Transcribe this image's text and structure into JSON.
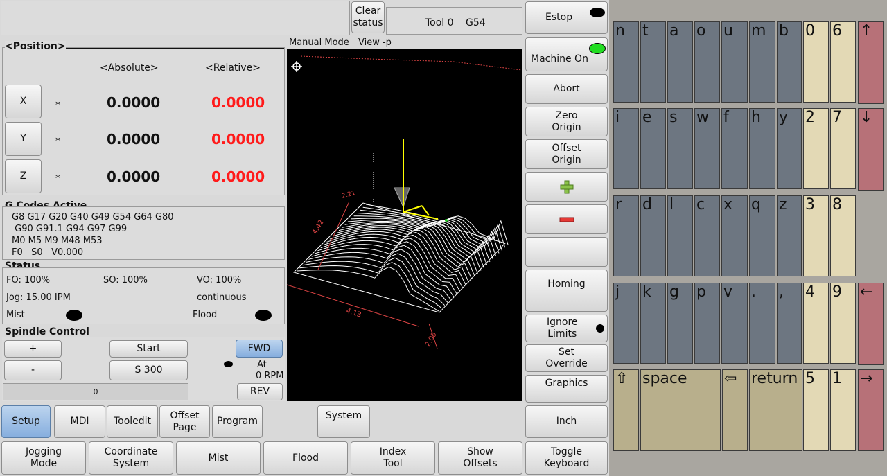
{
  "top": {
    "clear_status": "Clear\nstatus",
    "tool": "Tool 0",
    "coord": "G54"
  },
  "position": {
    "title": "<Position>",
    "abs_header": "<Absolute>",
    "rel_header": "<Relative>",
    "axes": [
      {
        "label": "X",
        "marker": "*",
        "abs": "0.0000",
        "rel": "0.0000"
      },
      {
        "label": "Y",
        "marker": "*",
        "abs": "0.0000",
        "rel": "0.0000"
      },
      {
        "label": "Z",
        "marker": "*",
        "abs": "0.0000",
        "rel": "0.0000"
      }
    ]
  },
  "gcodes": {
    "title": "G Codes Active",
    "lines": [
      "G8 G17 G20 G40 G49 G54 G64 G80",
      " G90 G91.1 G94 G97 G99",
      "M0 M5 M9 M48 M53",
      "F0   S0   V0.000"
    ]
  },
  "status": {
    "title": "Status",
    "fo": "FO: 100%",
    "so": "SO: 100%",
    "vo": "VO: 100%",
    "jog": "Jog: 15.00 IPM",
    "mode": "continuous",
    "mist": "Mist",
    "flood": "Flood"
  },
  "spindle": {
    "title": "Spindle Control",
    "plus": "+",
    "minus": "-",
    "start": "Start",
    "speed": "S 300",
    "fwd": "FWD",
    "at": "At",
    "rpm": "0 RPM",
    "rev": "REV",
    "bar_value": "0"
  },
  "viewport": {
    "mode": "Manual Mode",
    "view": "View -p",
    "dim1": "4.13",
    "dim2": "2.09",
    "dim3": "4.42",
    "dim4": "2.21"
  },
  "tabs": [
    "Setup",
    "MDI",
    "Tooledit",
    "Offset\nPage",
    "Program"
  ],
  "system_btn": "System",
  "bottom_buttons": [
    "Jogging\nMode",
    "Coordinate\nSystem",
    "Mist",
    "Flood",
    "Index\nTool",
    "Show\nOffsets"
  ],
  "right": {
    "estop": "Estop",
    "machine_on": "Machine On",
    "abort": "Abort",
    "zero_origin": "Zero\nOrigin",
    "offset_origin": "Offset\nOrigin",
    "homing": "Homing",
    "ignore_limits": "Ignore\nLimits",
    "set_override": "Set\nOverride",
    "graphics": "Graphics",
    "inch": "Inch",
    "toggle_keyboard": "Toggle\nKeyboard"
  },
  "keyboard": {
    "row1": [
      "n",
      "t",
      "a",
      "o",
      "u",
      "m",
      "b",
      "0",
      "6",
      "↑"
    ],
    "row2": [
      "i",
      "e",
      "s",
      "w",
      "f",
      "h",
      "y",
      "2",
      "7",
      "↓"
    ],
    "row3": [
      "r",
      "d",
      "l",
      "c",
      "x",
      "q",
      "z",
      "3",
      "8"
    ],
    "row4": [
      "j",
      "k",
      "g",
      "p",
      "v",
      ".",
      ",",
      "4",
      "9",
      "←"
    ],
    "row5": [
      "⇧",
      "space",
      "⇦",
      "return",
      "5",
      "1",
      "→"
    ]
  },
  "colors": {
    "relative_value": "#ff1a1a",
    "machine_on_led": "#22dd22",
    "key_letter": "#6d7681",
    "key_digit": "#e3d9b5",
    "key_arrow": "#b77178"
  }
}
